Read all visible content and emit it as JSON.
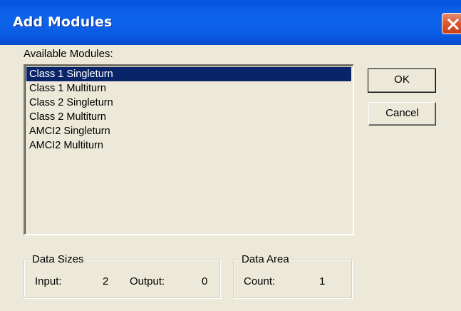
{
  "window": {
    "title": "Add Modules",
    "close_icon": "close-x-icon"
  },
  "available_modules": {
    "label": "Available Modules:",
    "items": [
      {
        "label": "Class 1 Singleturn",
        "selected": true
      },
      {
        "label": "Class 1 Multiturn",
        "selected": false
      },
      {
        "label": "Class 2 Singleturn",
        "selected": false
      },
      {
        "label": "Class 2 Multiturn",
        "selected": false
      },
      {
        "label": "AMCI2 Singleturn",
        "selected": false
      },
      {
        "label": "AMCI2 Multiturn",
        "selected": false
      }
    ]
  },
  "buttons": {
    "ok": "OK",
    "cancel": "Cancel"
  },
  "data_sizes": {
    "title": "Data Sizes",
    "input_label": "Input:",
    "input_value": "2",
    "output_label": "Output:",
    "output_value": "0"
  },
  "data_area": {
    "title": "Data Area",
    "count_label": "Count:",
    "count_value": "1"
  },
  "colors": {
    "titlebar": "#0a5ce6",
    "selection": "#0a246a",
    "dialog_face": "#ece9d8",
    "close_button": "#d9572f"
  }
}
